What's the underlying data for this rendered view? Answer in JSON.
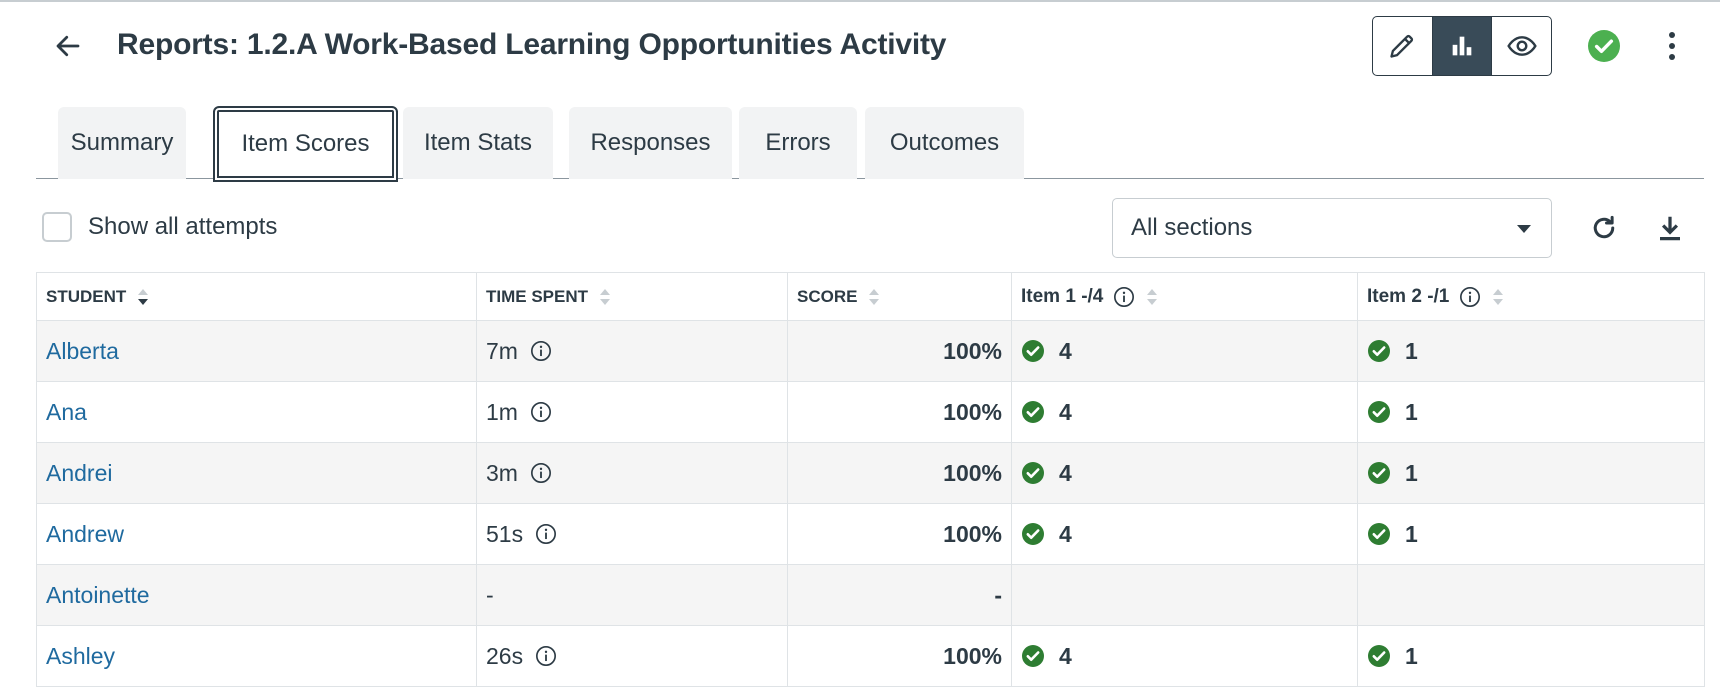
{
  "header": {
    "title": "Reports: 1.2.A Work-Based Learning Opportunities Activity",
    "back_icon": "arrow-left-icon",
    "view_modes": [
      {
        "icon": "pencil-icon",
        "active": false
      },
      {
        "icon": "bar-chart-icon",
        "active": true
      },
      {
        "icon": "eye-icon",
        "active": false
      }
    ],
    "status_icon": "check-circle-icon",
    "status_color": "#4cb050",
    "menu_icon": "kebab-menu-icon"
  },
  "tabs": [
    {
      "label": "Summary",
      "active": false
    },
    {
      "label": "Item Scores",
      "active": true
    },
    {
      "label": "Item Stats",
      "active": false
    },
    {
      "label": "Responses",
      "active": false
    },
    {
      "label": "Errors",
      "active": false
    },
    {
      "label": "Outcomes",
      "active": false
    }
  ],
  "toolbar": {
    "show_all_attempts_label": "Show all attempts",
    "show_all_attempts_checked": false,
    "section_select_value": "All sections",
    "refresh_icon": "refresh-icon",
    "download_icon": "download-icon"
  },
  "table": {
    "columns": [
      {
        "label": "STUDENT",
        "sorted": "desc"
      },
      {
        "label": "TIME SPENT",
        "sorted": "none"
      },
      {
        "label": "SCORE",
        "sorted": "none"
      },
      {
        "label": "Item 1 -/4",
        "sorted": "none",
        "info": true
      },
      {
        "label": "Item 2 -/1",
        "sorted": "none",
        "info": true
      }
    ],
    "correct_color": "#2e7d32",
    "link_color": "#1f6a9f",
    "rows": [
      {
        "student": "Alberta",
        "time": "7m",
        "time_info": true,
        "score": "100%",
        "item1": "4",
        "item2": "1",
        "item1_ok": true,
        "item2_ok": true
      },
      {
        "student": "Ana",
        "time": "1m",
        "time_info": true,
        "score": "100%",
        "item1": "4",
        "item2": "1",
        "item1_ok": true,
        "item2_ok": true
      },
      {
        "student": "Andrei",
        "time": "3m",
        "time_info": true,
        "score": "100%",
        "item1": "4",
        "item2": "1",
        "item1_ok": true,
        "item2_ok": true
      },
      {
        "student": "Andrew",
        "time": "51s",
        "time_info": true,
        "score": "100%",
        "item1": "4",
        "item2": "1",
        "item1_ok": true,
        "item2_ok": true
      },
      {
        "student": "Antoinette",
        "time": "-",
        "time_info": false,
        "score": "-",
        "item1": "",
        "item2": "",
        "item1_ok": false,
        "item2_ok": false
      },
      {
        "student": "Ashley",
        "time": "26s",
        "time_info": true,
        "score": "100%",
        "item1": "4",
        "item2": "1",
        "item1_ok": true,
        "item2_ok": true
      }
    ]
  }
}
